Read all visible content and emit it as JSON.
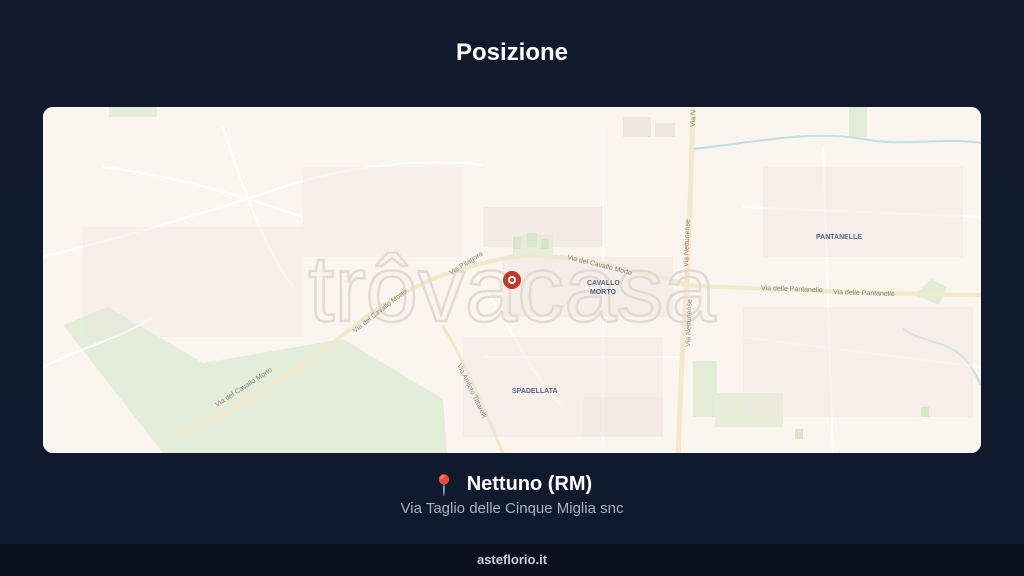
{
  "header": {
    "title": "Posizione"
  },
  "map": {
    "watermark": "trôvacasa",
    "place_labels": [
      "PANTANELLE",
      "CAVALLO",
      "MORTO",
      "SPADELLATA"
    ],
    "street_labels": [
      "Via Nettunense",
      "Via Nettunense",
      "Via del Cavallo Morto",
      "Via del Cavallo Morto",
      "Via del Cavallo Morto",
      "Via delle Pantanelle",
      "Via delle Pantanelle",
      "Via Pitagora",
      "Via Amleto Tittarelli",
      "Via N"
    ],
    "marker_color": "#c0392b",
    "colors": {
      "background": "#fbf5f0",
      "green": "#e4edd9",
      "road": "#f3e8c8",
      "water": "#bfe0ea"
    }
  },
  "location": {
    "pin_icon": "📍",
    "title": "Nettuno (RM)",
    "address": "Via Taglio delle Cinque Miglia snc"
  },
  "footer": {
    "site": "asteflorio.it"
  }
}
